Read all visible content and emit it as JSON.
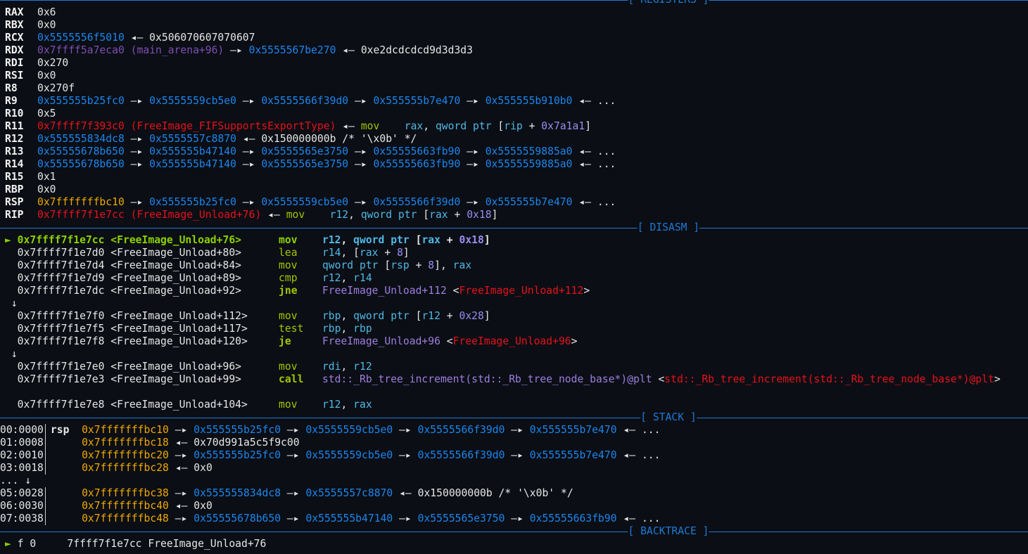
{
  "headers": {
    "registers": "[ REGISTERS ]",
    "disasm": "[ DISASM ]",
    "stack": "[ STACK ]",
    "backtrace": "[ BACKTRACE ]"
  },
  "colors": {
    "background": "#0b0e14",
    "rule": "#1e7ad6",
    "pointer": "#1c86ee",
    "code": "#e5121c",
    "stack": "#f0a800",
    "heap_arena": "#7d4fb5",
    "mnemonic": "#a5c400"
  },
  "registers": [
    {
      "name": "RAX",
      "segs": [
        {
          "t": "0x6",
          "c": "w"
        }
      ]
    },
    {
      "name": "RBX",
      "segs": [
        {
          "t": "0x0",
          "c": "w"
        }
      ]
    },
    {
      "name": "RCX",
      "segs": [
        {
          "t": "0x5555556f5010",
          "c": "b"
        },
        {
          "t": " ◂— 0x506070607070607",
          "c": "w"
        }
      ]
    },
    {
      "name": "RDX",
      "segs": [
        {
          "t": "0x7ffff5a7eca0 (main_arena+96)",
          "c": "p"
        },
        {
          "t": " —▸ ",
          "c": "w"
        },
        {
          "t": "0x5555567be270",
          "c": "b"
        },
        {
          "t": " ◂— 0xe2dcdcdcd9d3d3d3",
          "c": "w"
        }
      ]
    },
    {
      "name": "RDI",
      "segs": [
        {
          "t": "0x270",
          "c": "w"
        }
      ]
    },
    {
      "name": "RSI",
      "segs": [
        {
          "t": "0x0",
          "c": "w"
        }
      ]
    },
    {
      "name": "R8",
      "segs": [
        {
          "t": "0x270f",
          "c": "w"
        }
      ]
    },
    {
      "name": "R9",
      "segs": [
        {
          "t": "0x555555b25fc0",
          "c": "b"
        },
        {
          "t": " —▸ ",
          "c": "w"
        },
        {
          "t": "0x5555559cb5e0",
          "c": "b"
        },
        {
          "t": " —▸ ",
          "c": "w"
        },
        {
          "t": "0x5555566f39d0",
          "c": "b"
        },
        {
          "t": " —▸ ",
          "c": "w"
        },
        {
          "t": "0x555555b7e470",
          "c": "b"
        },
        {
          "t": " —▸ ",
          "c": "w"
        },
        {
          "t": "0x555555b910b0",
          "c": "b"
        },
        {
          "t": " ◂— ...",
          "c": "w"
        }
      ]
    },
    {
      "name": "R10",
      "segs": [
        {
          "t": "0x5",
          "c": "w"
        }
      ]
    },
    {
      "name": "R11",
      "segs": [
        {
          "t": "0x7ffff7f393c0 (FreeImage_FIFSupportsExportType)",
          "c": "r"
        },
        {
          "t": " ◂— ",
          "c": "w"
        },
        {
          "t": "mov",
          "c": "g"
        },
        {
          "t": "    ",
          "c": "w"
        },
        {
          "t": "rax",
          "c": "c"
        },
        {
          "t": ", ",
          "c": "w"
        },
        {
          "t": "qword ptr",
          "c": "c"
        },
        {
          "t": " [",
          "c": "w"
        },
        {
          "t": "rip",
          "c": "c"
        },
        {
          "t": " + ",
          "c": "w"
        },
        {
          "t": "0x7a1a1",
          "c": "n"
        },
        {
          "t": "]",
          "c": "w"
        }
      ]
    },
    {
      "name": "R12",
      "segs": [
        {
          "t": "0x555555834dc8",
          "c": "b"
        },
        {
          "t": " —▸ ",
          "c": "w"
        },
        {
          "t": "0x5555557c8870",
          "c": "b"
        },
        {
          "t": " ◂— 0x150000000b /* '\\x0b' */",
          "c": "w"
        }
      ]
    },
    {
      "name": "R13",
      "segs": [
        {
          "t": "0x55555678b650",
          "c": "b"
        },
        {
          "t": " —▸ ",
          "c": "w"
        },
        {
          "t": "0x555555b47140",
          "c": "b"
        },
        {
          "t": " —▸ ",
          "c": "w"
        },
        {
          "t": "0x5555565e3750",
          "c": "b"
        },
        {
          "t": " —▸ ",
          "c": "w"
        },
        {
          "t": "0x55555663fb90",
          "c": "b"
        },
        {
          "t": " —▸ ",
          "c": "w"
        },
        {
          "t": "0x5555559885a0",
          "c": "b"
        },
        {
          "t": " ◂— ...",
          "c": "w"
        }
      ]
    },
    {
      "name": "R14",
      "segs": [
        {
          "t": "0x55555678b650",
          "c": "b"
        },
        {
          "t": " —▸ ",
          "c": "w"
        },
        {
          "t": "0x555555b47140",
          "c": "b"
        },
        {
          "t": " —▸ ",
          "c": "w"
        },
        {
          "t": "0x5555565e3750",
          "c": "b"
        },
        {
          "t": " —▸ ",
          "c": "w"
        },
        {
          "t": "0x55555663fb90",
          "c": "b"
        },
        {
          "t": " —▸ ",
          "c": "w"
        },
        {
          "t": "0x5555559885a0",
          "c": "b"
        },
        {
          "t": " ◂— ...",
          "c": "w"
        }
      ]
    },
    {
      "name": "R15",
      "segs": [
        {
          "t": "0x1",
          "c": "w"
        }
      ]
    },
    {
      "name": "RBP",
      "segs": [
        {
          "t": "0x0",
          "c": "w"
        }
      ]
    },
    {
      "name": "RSP",
      "segs": [
        {
          "t": "0x7fffffffbc10",
          "c": "y"
        },
        {
          "t": " —▸ ",
          "c": "w"
        },
        {
          "t": "0x555555b25fc0",
          "c": "b"
        },
        {
          "t": " —▸ ",
          "c": "w"
        },
        {
          "t": "0x5555559cb5e0",
          "c": "b"
        },
        {
          "t": " —▸ ",
          "c": "w"
        },
        {
          "t": "0x5555566f39d0",
          "c": "b"
        },
        {
          "t": " —▸ ",
          "c": "w"
        },
        {
          "t": "0x555555b7e470",
          "c": "b"
        },
        {
          "t": " ◂— ...",
          "c": "w"
        }
      ]
    },
    {
      "name": "RIP",
      "segs": [
        {
          "t": "0x7ffff7f1e7cc (FreeImage_Unload+76)",
          "c": "r"
        },
        {
          "t": " ◂— ",
          "c": "w"
        },
        {
          "t": "mov",
          "c": "g"
        },
        {
          "t": "    ",
          "c": "w"
        },
        {
          "t": "r12",
          "c": "c"
        },
        {
          "t": ", ",
          "c": "w"
        },
        {
          "t": "qword ptr",
          "c": "c"
        },
        {
          "t": " [",
          "c": "w"
        },
        {
          "t": "rax",
          "c": "c"
        },
        {
          "t": " + ",
          "c": "w"
        },
        {
          "t": "0x18",
          "c": "n"
        },
        {
          "t": "]",
          "c": "w"
        }
      ]
    }
  ],
  "disasm": [
    {
      "marker": "►",
      "current": true,
      "addr": "0x7ffff7f1e7cc <FreeImage_Unload+76>",
      "mnem": "mov",
      "bold": true,
      "ops": [
        {
          "t": "r12",
          "c": "c"
        },
        {
          "t": ", ",
          "c": "w"
        },
        {
          "t": "qword ptr",
          "c": "c"
        },
        {
          "t": " [",
          "c": "w"
        },
        {
          "t": "rax",
          "c": "c"
        },
        {
          "t": " + ",
          "c": "w"
        },
        {
          "t": "0x18",
          "c": "n"
        },
        {
          "t": "]",
          "c": "w"
        }
      ]
    },
    {
      "addr": "0x7ffff7f1e7d0 <FreeImage_Unload+80>",
      "mnem": "lea",
      "ops": [
        {
          "t": "r14",
          "c": "c"
        },
        {
          "t": ", [",
          "c": "w"
        },
        {
          "t": "rax",
          "c": "c"
        },
        {
          "t": " + ",
          "c": "w"
        },
        {
          "t": "8",
          "c": "n"
        },
        {
          "t": "]",
          "c": "w"
        }
      ]
    },
    {
      "addr": "0x7ffff7f1e7d4 <FreeImage_Unload+84>",
      "mnem": "mov",
      "ops": [
        {
          "t": "qword ptr",
          "c": "c"
        },
        {
          "t": " [",
          "c": "w"
        },
        {
          "t": "rsp",
          "c": "c"
        },
        {
          "t": " + ",
          "c": "w"
        },
        {
          "t": "8",
          "c": "n"
        },
        {
          "t": "], ",
          "c": "w"
        },
        {
          "t": "rax",
          "c": "c"
        }
      ]
    },
    {
      "addr": "0x7ffff7f1e7d9 <FreeImage_Unload+89>",
      "mnem": "cmp",
      "ops": [
        {
          "t": "r12",
          "c": "c"
        },
        {
          "t": ", ",
          "c": "w"
        },
        {
          "t": "r14",
          "c": "c"
        }
      ]
    },
    {
      "addr": "0x7ffff7f1e7dc <FreeImage_Unload+92>",
      "mnem": "jne",
      "bold": true,
      "ops": [
        {
          "t": "FreeImage_Unload+112",
          "c": "v"
        },
        {
          "t": " <",
          "c": "w"
        },
        {
          "t": "FreeImage_Unload+112",
          "c": "r"
        },
        {
          "t": ">",
          "c": "w"
        }
      ]
    },
    {
      "arrow": " ↓"
    },
    {
      "addr": "0x7ffff7f1e7f0 <FreeImage_Unload+112>",
      "mnem": "mov",
      "ops": [
        {
          "t": "rbp",
          "c": "c"
        },
        {
          "t": ", ",
          "c": "w"
        },
        {
          "t": "qword ptr",
          "c": "c"
        },
        {
          "t": " [",
          "c": "w"
        },
        {
          "t": "r12",
          "c": "c"
        },
        {
          "t": " + ",
          "c": "w"
        },
        {
          "t": "0x28",
          "c": "n"
        },
        {
          "t": "]",
          "c": "w"
        }
      ]
    },
    {
      "addr": "0x7ffff7f1e7f5 <FreeImage_Unload+117>",
      "mnem": "test",
      "ops": [
        {
          "t": "rbp",
          "c": "c"
        },
        {
          "t": ", ",
          "c": "w"
        },
        {
          "t": "rbp",
          "c": "c"
        }
      ]
    },
    {
      "addr": "0x7ffff7f1e7f8 <FreeImage_Unload+120>",
      "mnem": "je",
      "bold": true,
      "ops": [
        {
          "t": "FreeImage_Unload+96",
          "c": "v"
        },
        {
          "t": " <",
          "c": "w"
        },
        {
          "t": "FreeImage_Unload+96",
          "c": "r"
        },
        {
          "t": ">",
          "c": "w"
        }
      ]
    },
    {
      "arrow": " ↓"
    },
    {
      "addr": "0x7ffff7f1e7e0 <FreeImage_Unload+96>",
      "mnem": "mov",
      "ops": [
        {
          "t": "rdi",
          "c": "c"
        },
        {
          "t": ", ",
          "c": "w"
        },
        {
          "t": "r12",
          "c": "c"
        }
      ]
    },
    {
      "addr": "0x7ffff7f1e7e3 <FreeImage_Unload+99>",
      "mnem": "call",
      "bold": true,
      "ops": [
        {
          "t": "std::_Rb_tree_increment(std::_Rb_tree_node_base*)@plt",
          "c": "v"
        },
        {
          "t": " <",
          "c": "w"
        },
        {
          "t": "std::_Rb_tree_increment(std::_Rb_tree_node_base*)@plt",
          "c": "r"
        },
        {
          "t": ">",
          "c": "w"
        }
      ]
    },
    {
      "blank": true
    },
    {
      "addr": "0x7ffff7f1e7e8 <FreeImage_Unload+104>",
      "mnem": "mov",
      "ops": [
        {
          "t": "r12",
          "c": "c"
        },
        {
          "t": ", ",
          "c": "w"
        },
        {
          "t": "rax",
          "c": "c"
        }
      ]
    }
  ],
  "stack": [
    {
      "off": "00:0000",
      "reg": "rsp",
      "segs": [
        {
          "t": "0x7fffffffbc10",
          "c": "y"
        },
        {
          "t": " —▸ ",
          "c": "w"
        },
        {
          "t": "0x555555b25fc0",
          "c": "b"
        },
        {
          "t": " —▸ ",
          "c": "w"
        },
        {
          "t": "0x5555559cb5e0",
          "c": "b"
        },
        {
          "t": " —▸ ",
          "c": "w"
        },
        {
          "t": "0x5555566f39d0",
          "c": "b"
        },
        {
          "t": " —▸ ",
          "c": "w"
        },
        {
          "t": "0x555555b7e470",
          "c": "b"
        },
        {
          "t": " ◂— ...",
          "c": "w"
        }
      ]
    },
    {
      "off": "01:0008",
      "reg": "",
      "segs": [
        {
          "t": "0x7fffffffbc18",
          "c": "y"
        },
        {
          "t": " ◂— 0x70d991a5c5f9c00",
          "c": "w"
        }
      ]
    },
    {
      "off": "02:0010",
      "reg": "",
      "segs": [
        {
          "t": "0x7fffffffbc20",
          "c": "y"
        },
        {
          "t": " —▸ ",
          "c": "w"
        },
        {
          "t": "0x555555b25fc0",
          "c": "b"
        },
        {
          "t": " —▸ ",
          "c": "w"
        },
        {
          "t": "0x5555559cb5e0",
          "c": "b"
        },
        {
          "t": " —▸ ",
          "c": "w"
        },
        {
          "t": "0x5555566f39d0",
          "c": "b"
        },
        {
          "t": " —▸ ",
          "c": "w"
        },
        {
          "t": "0x555555b7e470",
          "c": "b"
        },
        {
          "t": " ◂— ...",
          "c": "w"
        }
      ]
    },
    {
      "off": "03:0018",
      "reg": "",
      "segs": [
        {
          "t": "0x7fffffffbc28",
          "c": "y"
        },
        {
          "t": " ◂— 0x0",
          "c": "w"
        }
      ]
    },
    {
      "skip": "... ↓"
    },
    {
      "off": "05:0028",
      "reg": "",
      "segs": [
        {
          "t": "0x7fffffffbc38",
          "c": "y"
        },
        {
          "t": " —▸ ",
          "c": "w"
        },
        {
          "t": "0x555555834dc8",
          "c": "b"
        },
        {
          "t": " —▸ ",
          "c": "w"
        },
        {
          "t": "0x5555557c8870",
          "c": "b"
        },
        {
          "t": " ◂— 0x150000000b /* '\\x0b' */",
          "c": "w"
        }
      ]
    },
    {
      "off": "06:0030",
      "reg": "",
      "segs": [
        {
          "t": "0x7fffffffbc40",
          "c": "y"
        },
        {
          "t": " ◂— 0x0",
          "c": "w"
        }
      ]
    },
    {
      "off": "07:0038",
      "reg": "",
      "segs": [
        {
          "t": "0x7fffffffbc48",
          "c": "y"
        },
        {
          "t": " —▸ ",
          "c": "w"
        },
        {
          "t": "0x55555678b650",
          "c": "b"
        },
        {
          "t": " —▸ ",
          "c": "w"
        },
        {
          "t": "0x555555b47140",
          "c": "b"
        },
        {
          "t": " —▸ ",
          "c": "w"
        },
        {
          "t": "0x5555565e3750",
          "c": "b"
        },
        {
          "t": " —▸ ",
          "c": "w"
        },
        {
          "t": "0x55555663fb90",
          "c": "b"
        },
        {
          "t": " ◂— ...",
          "c": "w"
        }
      ]
    }
  ],
  "backtrace": [
    {
      "marker": "►",
      "frame": "f 0",
      "addr": "7ffff7f1e7cc FreeImage_Unload+76"
    }
  ]
}
